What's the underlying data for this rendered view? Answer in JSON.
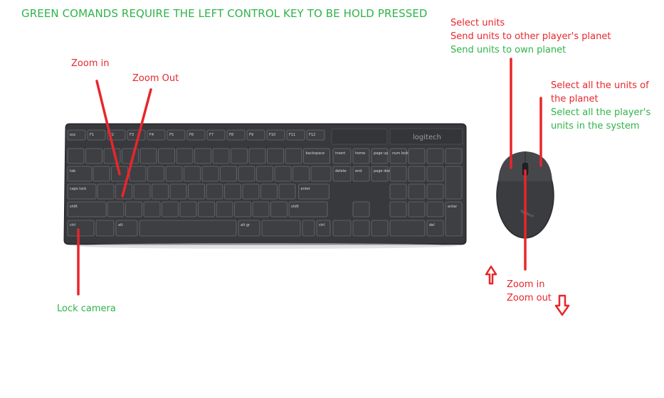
{
  "title": "GREEN COMANDS REQUIRE THE LEFT CONTROL KEY TO BE HOLD PRESSED",
  "keyboard": {
    "brand": "logitech",
    "labels": {
      "zoom_in": "Zoom in",
      "zoom_out": "Zoom Out",
      "lock_camera": "Lock camera"
    },
    "function_keys": [
      "esc",
      "F1",
      "F2",
      "F3",
      "F4",
      "F5",
      "F6",
      "F7",
      "F8",
      "F9",
      "F10",
      "F11",
      "F12"
    ],
    "key_captions": {
      "backspace": "backspace",
      "tab": "tab",
      "caps": "caps lock",
      "enter": "enter",
      "shift_l": "shift",
      "shift_r": "shift",
      "ctrl_l": "ctrl",
      "alt": "alt",
      "altgr": "alt gr",
      "ctrl_r": "ctrl",
      "insert": "insert",
      "home": "home",
      "pageup": "page up",
      "delete": "delete",
      "end": "end",
      "pagedown": "page down",
      "numlock": "num lock",
      "num_enter": "enter",
      "num_del": "del"
    }
  },
  "mouse": {
    "brand": "logitech",
    "left_click": {
      "line1": "Select units",
      "line2": "Send  units to other player's planet",
      "line3": "Send units to own planet"
    },
    "right_click": {
      "line1": "Select all the units of",
      "line2": "the planet",
      "line3": "Select all the player's",
      "line4": "units in the system"
    },
    "wheel": {
      "line1": "Zoom in",
      "line2": "Zoom out"
    }
  },
  "colors": {
    "red": "#e8262c",
    "green": "#2fb34a",
    "device": "#3d3f43"
  }
}
